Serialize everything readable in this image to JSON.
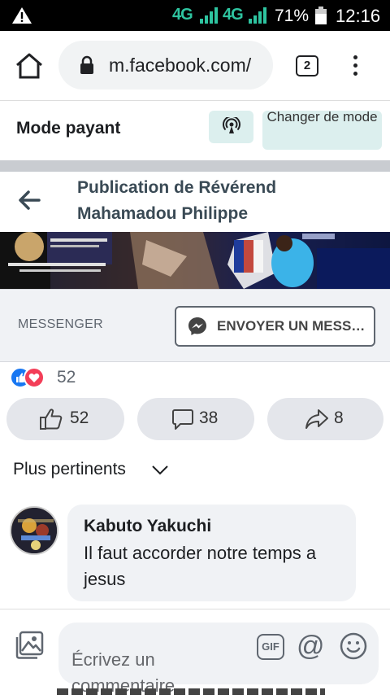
{
  "status_bar": {
    "network": "4G",
    "battery": "71%",
    "time": "12:16",
    "icons": [
      "warning-icon",
      "signal-icon",
      "battery-icon"
    ]
  },
  "browser": {
    "url": "m.facebook.com/",
    "tab_count": "2",
    "icons": [
      "home-icon",
      "lock-icon",
      "kebab-menu-icon"
    ]
  },
  "mode": {
    "title": "Mode payant",
    "change_label": "Changer de mode",
    "icon": "broadcast-icon"
  },
  "publication": {
    "title": "Publication de Révérend Mahamadou Philippe"
  },
  "messenger": {
    "label": "MESSENGER",
    "button": "ENVOYER UN MESS…"
  },
  "reactions": {
    "count": "52",
    "types": [
      "like",
      "love"
    ]
  },
  "actions": {
    "like_count": "52",
    "comment_count": "38",
    "share_count": "8"
  },
  "sort": {
    "label": "Plus pertinents"
  },
  "comments": [
    {
      "author": "Kabuto Yakuchi",
      "text": "Il faut accorder notre temps a jesus"
    }
  ],
  "composer": {
    "placeholder": "Écrivez un commentaire…",
    "gif_label": "GIF",
    "at_label": "@"
  },
  "colors": {
    "facebook_blue": "#1877f2",
    "love_red": "#f33e58",
    "mode_button_bg": "#dcefee",
    "status_network": "#2ec4a0"
  }
}
